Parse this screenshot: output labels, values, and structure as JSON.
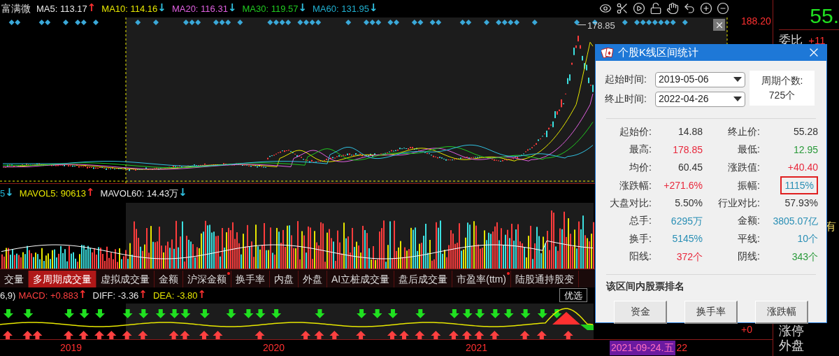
{
  "stock_name": "富满微",
  "ma_legend": [
    {
      "label": "MA5:",
      "value": "113.17",
      "color": "#e8e8e8",
      "arrow": {
        "text": "↑",
        "color": "#ff3030"
      }
    },
    {
      "label": "MA10:",
      "value": "114.16",
      "color": "#e6e600",
      "arrow": {
        "text": "↓",
        "color": "#30c0e0"
      }
    },
    {
      "label": "MA20:",
      "value": "116.31",
      "color": "#e060e0",
      "arrow": {
        "text": "↓",
        "color": "#30c0e0"
      }
    },
    {
      "label": "MA30:",
      "value": "119.57",
      "color": "#20c820",
      "arrow": {
        "text": "↓",
        "color": "#30c0e0"
      }
    },
    {
      "label": "MA60:",
      "value": "131.95",
      "color": "#20b0d0",
      "arrow": {
        "text": "↓",
        "color": "#30c0e0"
      }
    }
  ],
  "price_chart": {
    "peak_label": "178.85",
    "axis_high": "188.20"
  },
  "volume_legend": [
    {
      "value": "5",
      "color": "#20b0d0",
      "arrow": {
        "text": "↓",
        "color": "#30c0e0"
      }
    },
    {
      "label": "MAVOL5:",
      "value": "90613",
      "color": "#e6e600",
      "arrow": {
        "text": "↑",
        "color": "#ff3030"
      }
    },
    {
      "label": "MAVOL60:",
      "value": "14.43万",
      "color": "#e8e8e8",
      "arrow": {
        "text": "↓",
        "color": "#30c0e0"
      }
    }
  ],
  "tabs": [
    {
      "label": "交量",
      "selected": false,
      "dot": false
    },
    {
      "label": "多周期成交量",
      "selected": true,
      "dot": false
    },
    {
      "label": "虚拟成交量",
      "selected": false,
      "dot": false
    },
    {
      "label": "金额",
      "selected": false,
      "dot": false
    },
    {
      "label": "沪深金额",
      "selected": false,
      "dot": true
    },
    {
      "label": "换手率",
      "selected": false,
      "dot": false
    },
    {
      "label": "内盘",
      "selected": false,
      "dot": false
    },
    {
      "label": "外盘",
      "selected": false,
      "dot": false
    },
    {
      "label": "AI立桩成交量",
      "selected": false,
      "dot": false
    },
    {
      "label": "盘后成交量",
      "selected": false,
      "dot": false
    },
    {
      "label": "市盈率(ttm)",
      "selected": false,
      "dot": true
    },
    {
      "label": "陆股通持股变",
      "selected": false,
      "dot": false
    }
  ],
  "macd_legend": {
    "params": "6,9)",
    "items": [
      {
        "label": "MACD:",
        "value": "+0.883",
        "color": "#ff4040",
        "arrow": {
          "text": "↑",
          "color": "#ff3030"
        }
      },
      {
        "label": "DIFF:",
        "value": "-3.36",
        "color": "#e8e8e8",
        "arrow": {
          "text": "↑",
          "color": "#ff3030"
        }
      },
      {
        "label": "DEA:",
        "value": "-3.80",
        "color": "#e6e600",
        "arrow": {
          "text": "↑",
          "color": "#ff3030"
        }
      }
    ],
    "button": "优选",
    "axis_zero": "+0"
  },
  "x_axis": {
    "labels": [
      "2019",
      "2020",
      "2021"
    ],
    "cursor_date": "2021-09-24.五",
    "after_cursor": "22"
  },
  "right_panel": {
    "price": "55.",
    "ratio_label": "委比",
    "ratio_value": "+11",
    "side_char": "有",
    "items": [
      "涨停",
      "外盘"
    ]
  },
  "dialog": {
    "title": "个股K线区间统计",
    "start": {
      "label": "起始时间:",
      "value": "2019-05-06"
    },
    "end": {
      "label": "终止时间:",
      "value": "2022-04-26"
    },
    "count": {
      "label": "周期个数:",
      "value": "725个"
    },
    "stats": [
      {
        "label": "起始价:",
        "value": "14.88",
        "color": "#333333",
        "highlighted": false
      },
      {
        "label": "终止价:",
        "value": "55.28",
        "color": "#333333",
        "highlighted": false
      },
      {
        "label": "最高:",
        "value": "178.85",
        "color": "#e8283c",
        "highlighted": false
      },
      {
        "label": "最低:",
        "value": "12.95",
        "color": "#2a9a3a",
        "highlighted": false
      },
      {
        "label": "均价:",
        "value": "60.45",
        "color": "#333333",
        "highlighted": false
      },
      {
        "label": "涨跌值:",
        "value": "+40.40",
        "color": "#e8283c",
        "highlighted": false
      },
      {
        "label": "涨跌幅:",
        "value": "+271.6%",
        "color": "#e8283c",
        "highlighted": false
      },
      {
        "label": "振幅:",
        "value": "1115%",
        "color": "#2a8fb5",
        "highlighted": true
      },
      {
        "label": "大盘对比:",
        "value": "5.50%",
        "color": "#333333",
        "highlighted": false
      },
      {
        "label": "行业对比:",
        "value": "57.93%",
        "color": "#333333",
        "highlighted": false
      },
      {
        "label": "总手:",
        "value": "6295万",
        "color": "#2a8fb5",
        "highlighted": false
      },
      {
        "label": "金额:",
        "value": "3805.07亿",
        "color": "#2a8fb5",
        "highlighted": false
      },
      {
        "label": "换手:",
        "value": "5145%",
        "color": "#2a8fb5",
        "highlighted": false
      },
      {
        "label": "平线:",
        "value": "10个",
        "color": "#2a8fb5",
        "highlighted": false
      },
      {
        "label": "阳线:",
        "value": "372个",
        "color": "#e8283c",
        "highlighted": false
      },
      {
        "label": "阴线:",
        "value": "343个",
        "color": "#2a9a3a",
        "highlighted": false
      }
    ],
    "ranking_title": "该区间内股票排名",
    "buttons": [
      "资金",
      "换手率",
      "涨跌幅"
    ]
  }
}
